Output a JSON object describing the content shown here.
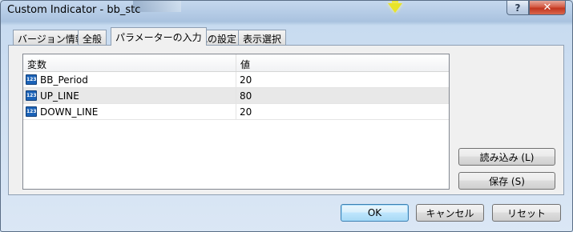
{
  "window": {
    "title": "Custom Indicator - bb_stc",
    "help_label": "?",
    "close_label": "✕"
  },
  "tabs": [
    {
      "label": "バージョン情報"
    },
    {
      "label": "全般"
    },
    {
      "label": "パラメーターの入力"
    },
    {
      "label": "色の設定"
    },
    {
      "label": "表示選択"
    }
  ],
  "active_tab": "パラメーターの入力",
  "grid": {
    "headers": {
      "variable": "変数",
      "value": "値"
    },
    "rows": [
      {
        "icon": "123",
        "name": "BB_Period",
        "value": "20"
      },
      {
        "icon": "123",
        "name": "UP_LINE",
        "value": "80"
      },
      {
        "icon": "123",
        "name": "DOWN_LINE",
        "value": "20"
      }
    ]
  },
  "side_buttons": {
    "load": "読み込み (L)",
    "save": "保存 (S)"
  },
  "footer": {
    "ok": "OK",
    "cancel": "キャンセル",
    "reset": "リセット"
  }
}
